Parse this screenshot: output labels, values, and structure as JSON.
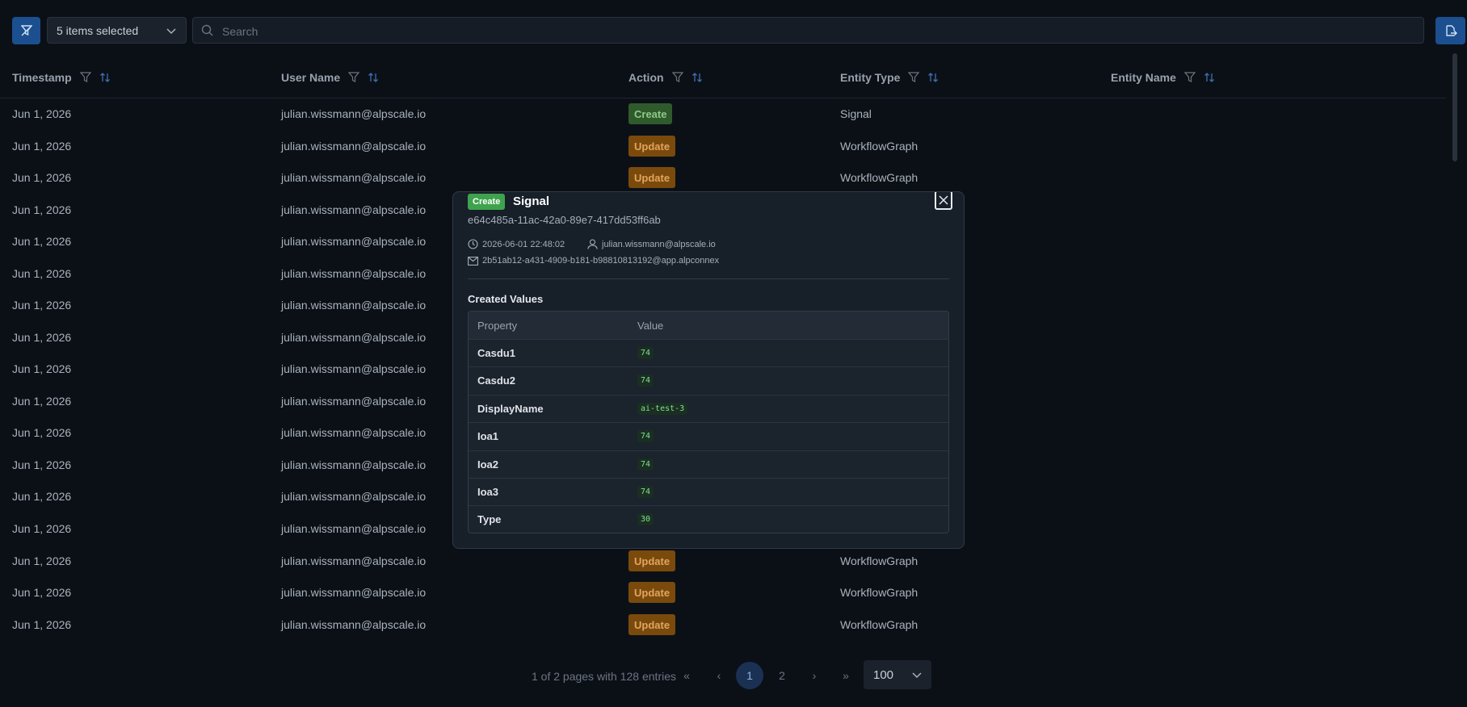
{
  "toolbar": {
    "selected_label": "5 items selected",
    "search_placeholder": "Search"
  },
  "columns": [
    {
      "label": "Timestamp"
    },
    {
      "label": "User Name"
    },
    {
      "label": "Action"
    },
    {
      "label": "Entity Type"
    },
    {
      "label": "Entity Name"
    }
  ],
  "rows": [
    {
      "timestamp": "Jun 1, 2026",
      "user": "julian.wissmann@alpscale.io",
      "action": "Create",
      "entity_type": "Signal"
    },
    {
      "timestamp": "Jun 1, 2026",
      "user": "julian.wissmann@alpscale.io",
      "action": "Update",
      "entity_type": "WorkflowGraph"
    },
    {
      "timestamp": "Jun 1, 2026",
      "user": "julian.wissmann@alpscale.io",
      "action": "Update",
      "entity_type": "WorkflowGraph"
    },
    {
      "timestamp": "Jun 1, 2026",
      "user": "julian.wissmann@alpscale.io",
      "action": "",
      "entity_type": ""
    },
    {
      "timestamp": "Jun 1, 2026",
      "user": "julian.wissmann@alpscale.io",
      "action": "",
      "entity_type": ""
    },
    {
      "timestamp": "Jun 1, 2026",
      "user": "julian.wissmann@alpscale.io",
      "action": "",
      "entity_type": ""
    },
    {
      "timestamp": "Jun 1, 2026",
      "user": "julian.wissmann@alpscale.io",
      "action": "",
      "entity_type": ""
    },
    {
      "timestamp": "Jun 1, 2026",
      "user": "julian.wissmann@alpscale.io",
      "action": "",
      "entity_type": ""
    },
    {
      "timestamp": "Jun 1, 2026",
      "user": "julian.wissmann@alpscale.io",
      "action": "",
      "entity_type": ""
    },
    {
      "timestamp": "Jun 1, 2026",
      "user": "julian.wissmann@alpscale.io",
      "action": "",
      "entity_type": ""
    },
    {
      "timestamp": "Jun 1, 2026",
      "user": "julian.wissmann@alpscale.io",
      "action": "",
      "entity_type": ""
    },
    {
      "timestamp": "Jun 1, 2026",
      "user": "julian.wissmann@alpscale.io",
      "action": "",
      "entity_type": ""
    },
    {
      "timestamp": "Jun 1, 2026",
      "user": "julian.wissmann@alpscale.io",
      "action": "",
      "entity_type": ""
    },
    {
      "timestamp": "Jun 1, 2026",
      "user": "julian.wissmann@alpscale.io",
      "action": "",
      "entity_type": ""
    },
    {
      "timestamp": "Jun 1, 2026",
      "user": "julian.wissmann@alpscale.io",
      "action": "Update",
      "entity_type": "WorkflowGraph"
    },
    {
      "timestamp": "Jun 1, 2026",
      "user": "julian.wissmann@alpscale.io",
      "action": "Update",
      "entity_type": "WorkflowGraph"
    },
    {
      "timestamp": "Jun 1, 2026",
      "user": "julian.wissmann@alpscale.io",
      "action": "Update",
      "entity_type": "WorkflowGraph"
    }
  ],
  "pagination": {
    "info": "1 of 2 pages with 128 entries",
    "first": "«",
    "prev": "‹",
    "pages": [
      "1",
      "2"
    ],
    "next": "›",
    "last": "»",
    "page_size": "100"
  },
  "modal": {
    "action_badge": "Create",
    "entity_type": "Signal",
    "entity_id": "e64c485a-11ac-42a0-89e7-417dd53ff6ab",
    "timestamp": "2026-06-01 22:48:02",
    "user": "julian.wissmann@alpscale.io",
    "email": "2b51ab12-a431-4909-b181-b98810813192@app.alpconnex",
    "section_title": "Created Values",
    "table_headers": {
      "property": "Property",
      "value": "Value"
    },
    "values": [
      {
        "property": "Casdu1",
        "value": "74"
      },
      {
        "property": "Casdu2",
        "value": "74"
      },
      {
        "property": "DisplayName",
        "value": "ai-test-3"
      },
      {
        "property": "Ioa1",
        "value": "74"
      },
      {
        "property": "Ioa2",
        "value": "74"
      },
      {
        "property": "Ioa3",
        "value": "74"
      },
      {
        "property": "Type",
        "value": "30"
      }
    ]
  },
  "colors": {
    "background": "#0b1017",
    "primary": "#1c4f8f",
    "create": "#2f5b2c",
    "update": "#7a4a0d",
    "modal_create": "#3fa34d"
  }
}
